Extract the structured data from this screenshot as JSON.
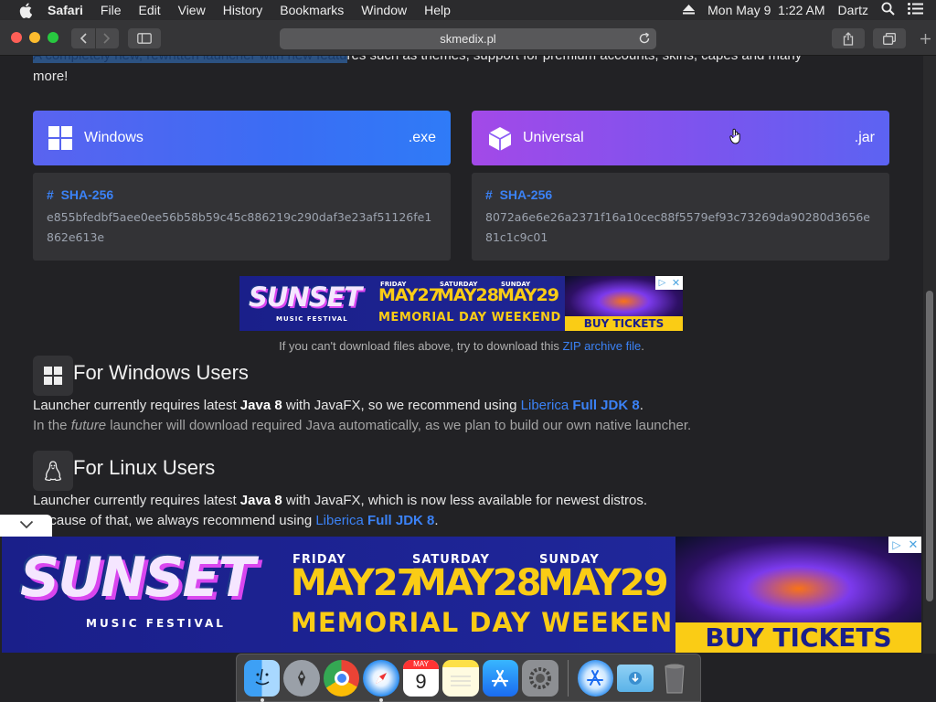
{
  "menubar": {
    "app_name": "Safari",
    "items": [
      "File",
      "Edit",
      "View",
      "History",
      "Bookmarks",
      "Window",
      "Help"
    ],
    "clock": "Mon May 9  1:22 AM",
    "user": "Dartz"
  },
  "toolbar": {
    "url": "skmedix.pl"
  },
  "page": {
    "intro_line1_highlight": "A completely new, rewritten launcher with new featu",
    "intro_line1_rest": "res such as themes, support for premium accounts, skins, capes and many",
    "intro_line2": "more!",
    "downloads": [
      {
        "label": "Windows",
        "ext": ".exe",
        "hash_title": "SHA-256",
        "hash": "e855bfedbf5aee0ee56b58b59c45c886219c290daf3e23af51126fe1862e613e"
      },
      {
        "label": "Universal",
        "ext": ".jar",
        "hash_title": "SHA-256",
        "hash": "8072a6e6e26a2371f16a10cec88f5579ef93c73269da90280d3656e81c1c9c01"
      }
    ],
    "note_prefix": "If you can't download files above, try to download this",
    "note_link": "ZIP archive file",
    "note_suffix": ".",
    "windows": {
      "heading": "For Windows Users",
      "p1_a": "Launcher currently requires latest",
      "p1_b": "Java 8",
      "p1_c": "with JavaFX, so we recommend using",
      "p1_link1": "Liberica",
      "p1_link2": "Full JDK 8",
      "p1_end": ".",
      "p2_a": "In the",
      "p2_b": "future",
      "p2_c": "launcher will download required Java automatically, as we plan to build our own native launcher."
    },
    "linux": {
      "heading": "For Linux Users",
      "p1_a": "Launcher currently requires latest",
      "p1_b": "Java 8",
      "p1_c": "with JavaFX, which is now less available for newest distros.",
      "p2_a": "Because of that, we always recommend using",
      "p2_link1": "Liberica",
      "p2_link2": "Full JDK 8",
      "p2_end": "."
    }
  },
  "ad": {
    "brand": "SUNSET",
    "sub": "MUSIC FESTIVAL",
    "days": [
      {
        "day": "FRIDAY",
        "date": "MAY27"
      },
      {
        "day": "SATURDAY",
        "date": "MAY28"
      },
      {
        "day": "SUNDAY",
        "date": "MAY29"
      }
    ],
    "tagline": "MEMORIAL DAY WEEKEND",
    "cta": "BUY TICKETS"
  },
  "dock": {
    "apps": [
      "finder-icon",
      "launchpad-icon",
      "chrome-icon",
      "safari-icon",
      "calendar-icon",
      "notes-icon",
      "app-store-icon",
      "system-preferences-icon",
      "applications-folder-icon",
      "downloads-folder-icon",
      "trash-icon"
    ],
    "calendar_month": "MAY",
    "calendar_day": "9"
  },
  "colors": {
    "accent": "#3b82f6",
    "page_bg": "#222225",
    "card_bg": "#333336",
    "windows_btn": "#3a6df4",
    "universal_btn": "#8a50ee",
    "ad_navy": "#1a1f8a",
    "ad_yellow": "#facc15"
  }
}
